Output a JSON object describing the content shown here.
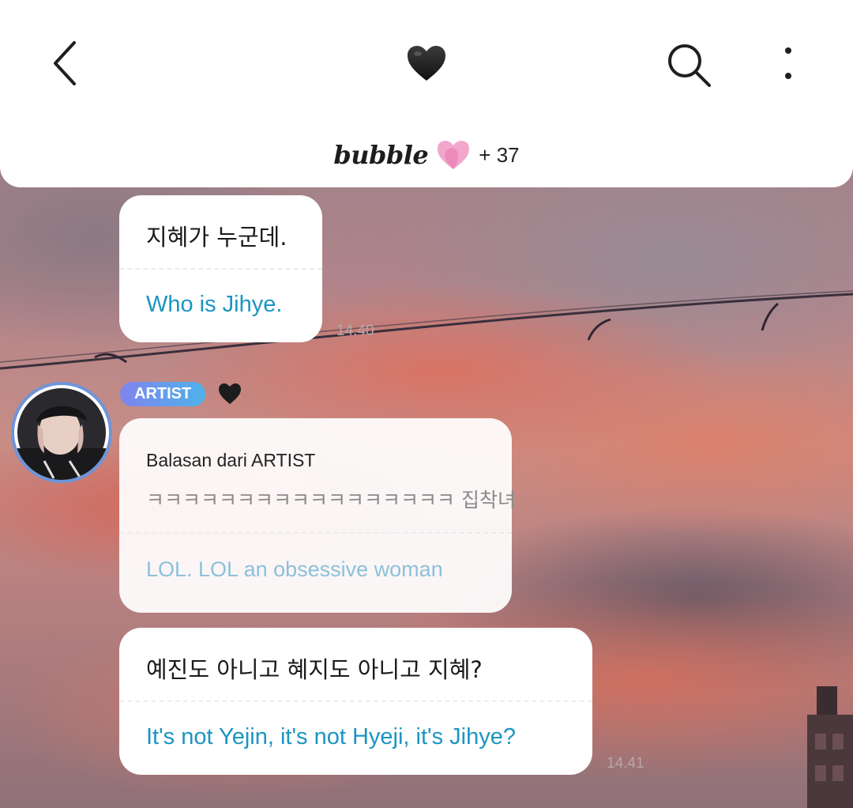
{
  "header": {
    "back_icon": "chevron-left-icon",
    "center_icon": "black-heart-icon",
    "search_icon": "search-icon",
    "more_icon": "vertical-dots-icon",
    "brand": "bubble",
    "brand_icon": "pink-heart-icon",
    "count": "+ 37"
  },
  "messages": [
    {
      "korean": "지혜가 누군데.",
      "translation": "Who is Jihye.",
      "time": "14.40"
    },
    {
      "badge": "ARTIST",
      "reply_label": "Balasan dari ARTIST",
      "korean": "ㅋㅋㅋㅋㅋㅋㅋㅋㅋㅋㅋㅋㅋㅋㅋㅋㅋ 집착녀",
      "translation": "LOL. LOL an obsessive woman"
    },
    {
      "korean": "예진도 아니고 혜지도 아니고 지혜?",
      "translation": "It's not Yejin, it's not Hyeji, it's Jihye?",
      "time": "14.41"
    }
  ],
  "colors": {
    "translation": "#1b95c1",
    "reply_translation": "#8dc0db",
    "badge_start": "#7f84ee",
    "badge_end": "#4fb2ea",
    "avatar_ring": "#6f94d8"
  }
}
